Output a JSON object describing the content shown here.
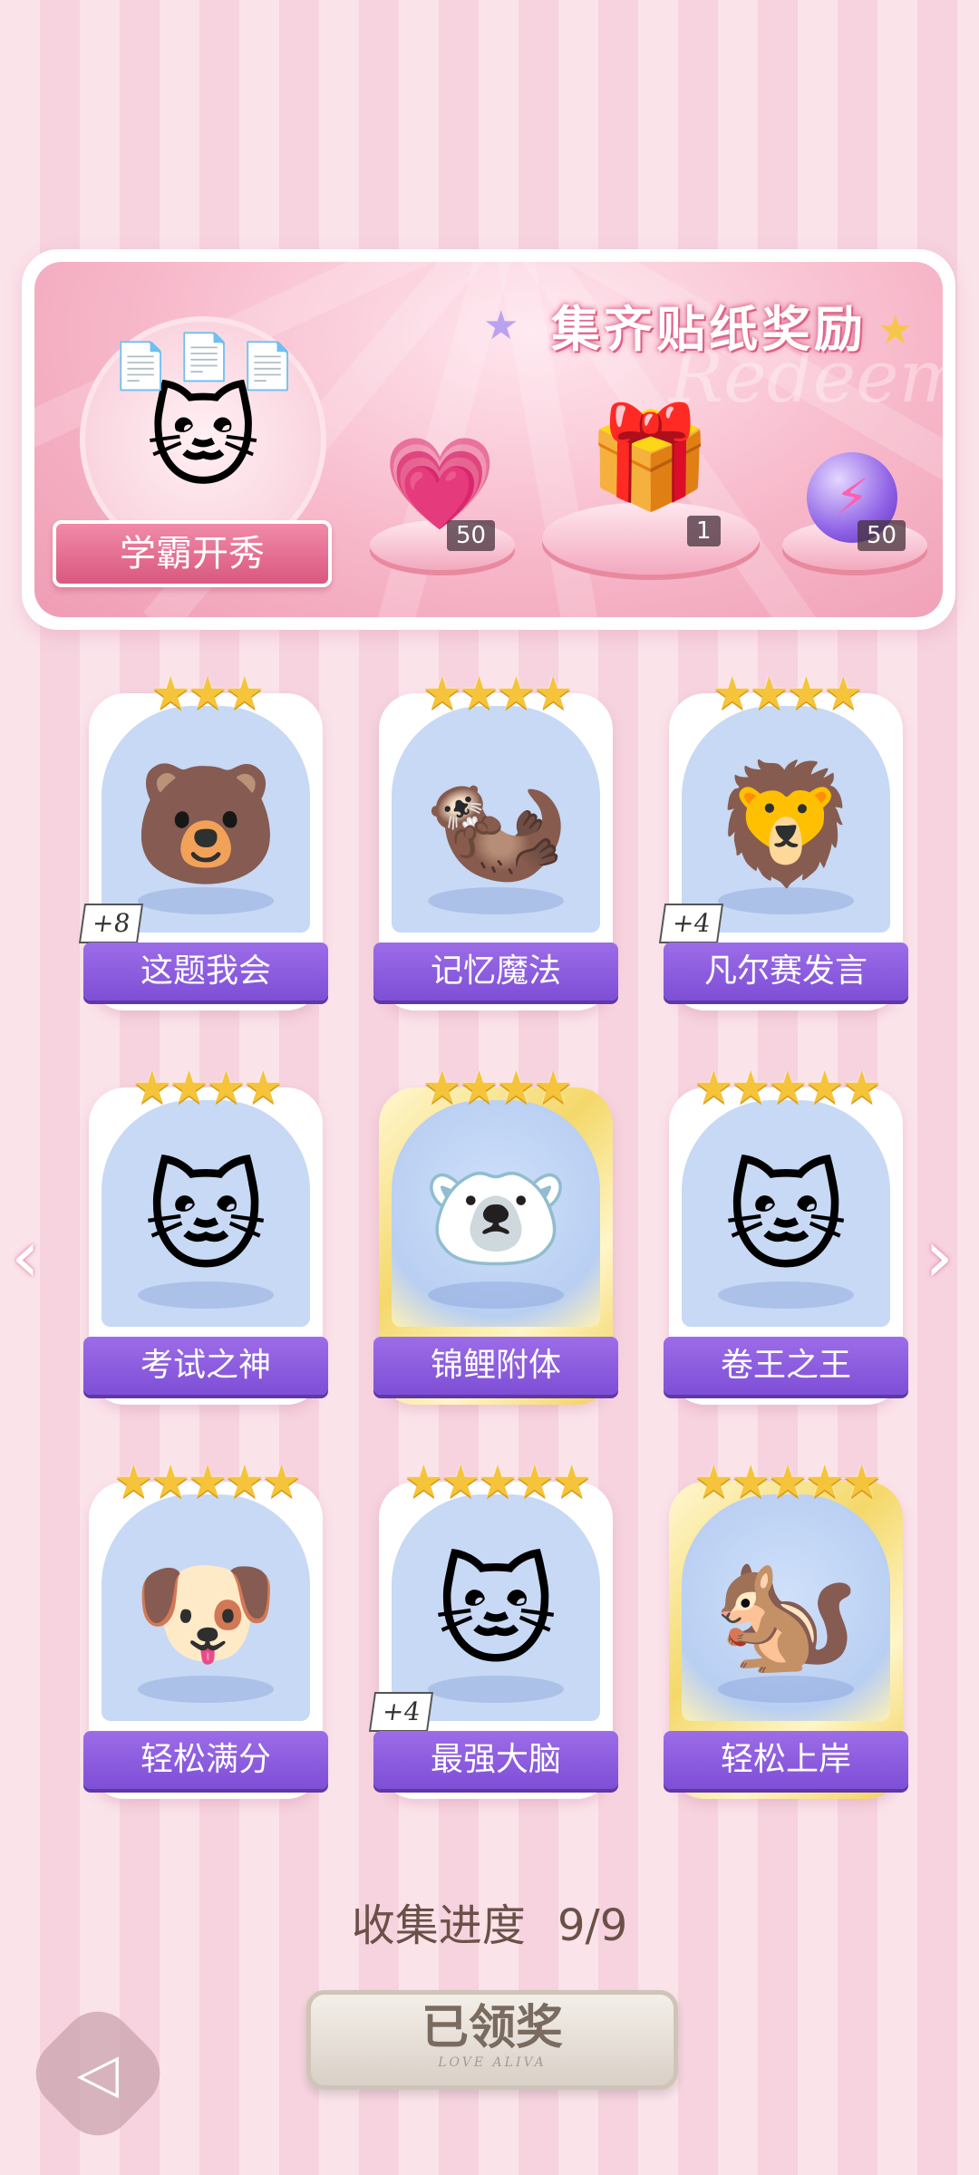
{
  "reward": {
    "title": "集齐贴纸奖励",
    "watermark": "Redeem",
    "theme_label": "学霸开秀",
    "items": [
      {
        "icon": "pink-heart-diamond-icon",
        "quantity": "50"
      },
      {
        "icon": "gift-box-icon",
        "quantity": "1"
      },
      {
        "icon": "purple-lightning-orb-icon",
        "quantity": "50"
      }
    ]
  },
  "stickers": [
    {
      "label": "这题我会",
      "stars": "★★★",
      "badge": "+8",
      "emoji": "🐻",
      "gold": false
    },
    {
      "label": "记忆魔法",
      "stars": "★★★★",
      "badge": "",
      "emoji": "🦦",
      "gold": false
    },
    {
      "label": "凡尔赛发言",
      "stars": "★★★★",
      "badge": "+4",
      "emoji": "🦁",
      "gold": false
    },
    {
      "label": "考试之神",
      "stars": "★★★★",
      "badge": "",
      "emoji": "🐱",
      "gold": false
    },
    {
      "label": "锦鲤附体",
      "stars": "★★★★",
      "badge": "",
      "emoji": "🐻‍❄️",
      "gold": true
    },
    {
      "label": "卷王之王",
      "stars": "★★★★★",
      "badge": "",
      "emoji": "🐱",
      "gold": false
    },
    {
      "label": "轻松满分",
      "stars": "★★★★★",
      "badge": "",
      "emoji": "🐶",
      "gold": false
    },
    {
      "label": "最强大脑",
      "stars": "★★★★★",
      "badge": "+4",
      "emoji": "🐱",
      "gold": false
    },
    {
      "label": "轻松上岸",
      "stars": "★★★★★",
      "badge": "",
      "emoji": "🐿️",
      "gold": true
    }
  ],
  "progress": {
    "label": "收集进度",
    "value": "9/9"
  },
  "claim_button": {
    "label": "已领奖",
    "sub": "LOVE ALIVA"
  },
  "nav": {
    "prev": "‹",
    "next": "›",
    "back": "◁"
  }
}
